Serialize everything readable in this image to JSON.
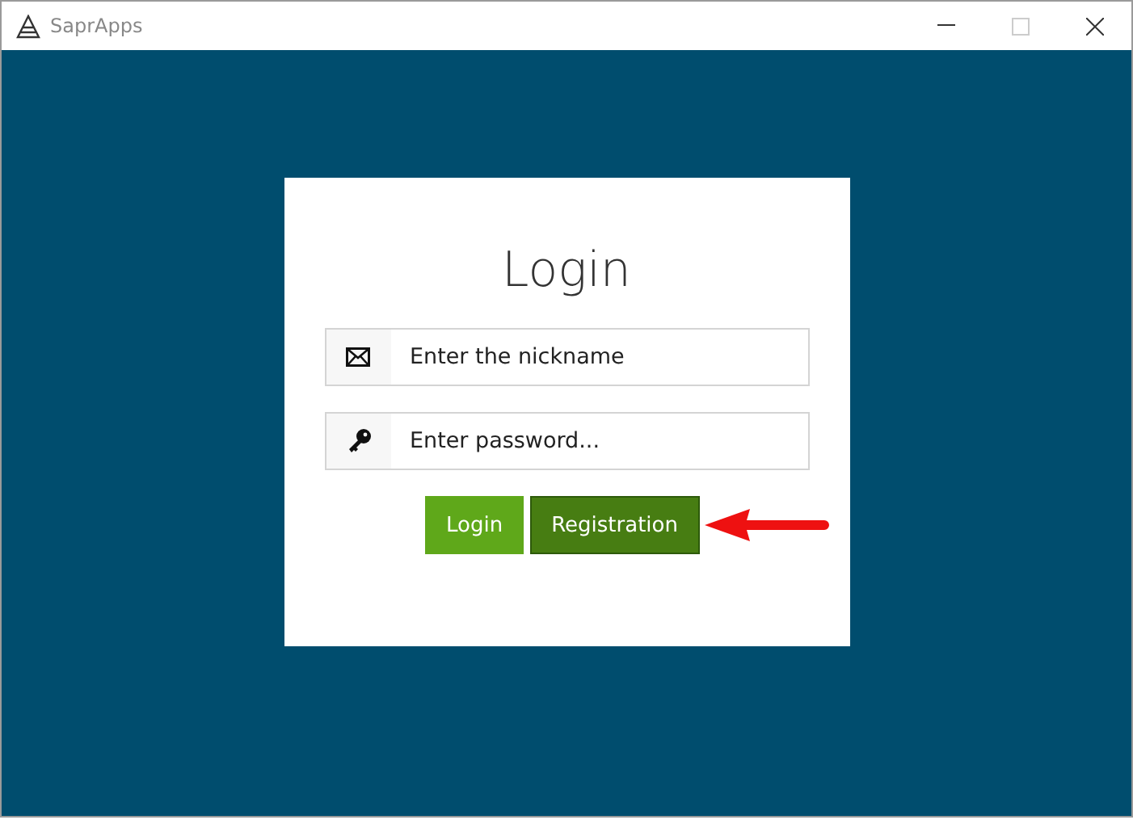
{
  "window": {
    "title": "SaprApps"
  },
  "login": {
    "heading": "Login",
    "fields": [
      {
        "kind": "email",
        "placeholder": "Enter the nickname"
      },
      {
        "kind": "password",
        "placeholder": "Enter password..."
      }
    ],
    "buttons": [
      {
        "label": "Login",
        "kind": "primary"
      },
      {
        "label": "Registration",
        "kind": "secondary"
      }
    ]
  }
}
